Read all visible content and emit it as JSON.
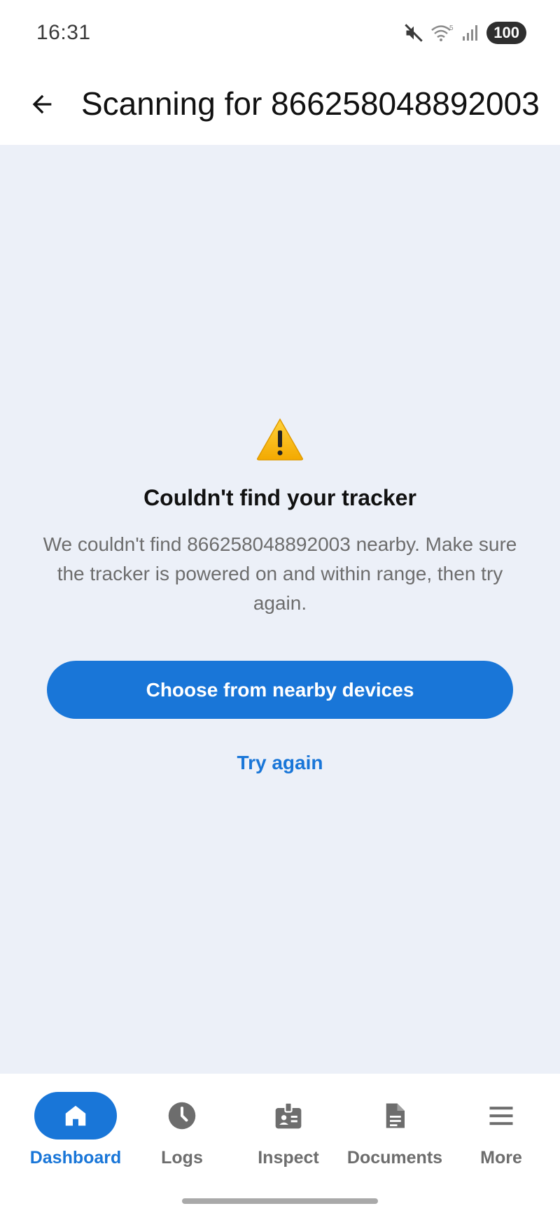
{
  "status_bar": {
    "time": "16:31",
    "battery": "100",
    "icons": [
      "mute-icon",
      "wifi-icon",
      "signal-icon",
      "battery-icon"
    ]
  },
  "app_bar": {
    "back_icon": "arrow-back-icon",
    "title": "Scanning for 866258048892003"
  },
  "error": {
    "icon": "warning-icon",
    "title": "Couldn't find your tracker",
    "message": "We couldn't find 866258048892003 nearby. Make sure the tracker is powered on and within range, then try again."
  },
  "actions": {
    "primary_label": "Choose from nearby devices",
    "secondary_label": "Try again"
  },
  "bottom_nav": {
    "items": [
      {
        "label": "Dashboard",
        "icon": "home-icon",
        "active": true
      },
      {
        "label": "Logs",
        "icon": "clock-icon",
        "active": false
      },
      {
        "label": "Inspect",
        "icon": "badge-icon",
        "active": false
      },
      {
        "label": "Documents",
        "icon": "document-icon",
        "active": false
      },
      {
        "label": "More",
        "icon": "menu-icon",
        "active": false
      }
    ]
  },
  "colors": {
    "accent": "#1976d8",
    "background": "#ecf0f8",
    "warning": "#f5b800"
  }
}
